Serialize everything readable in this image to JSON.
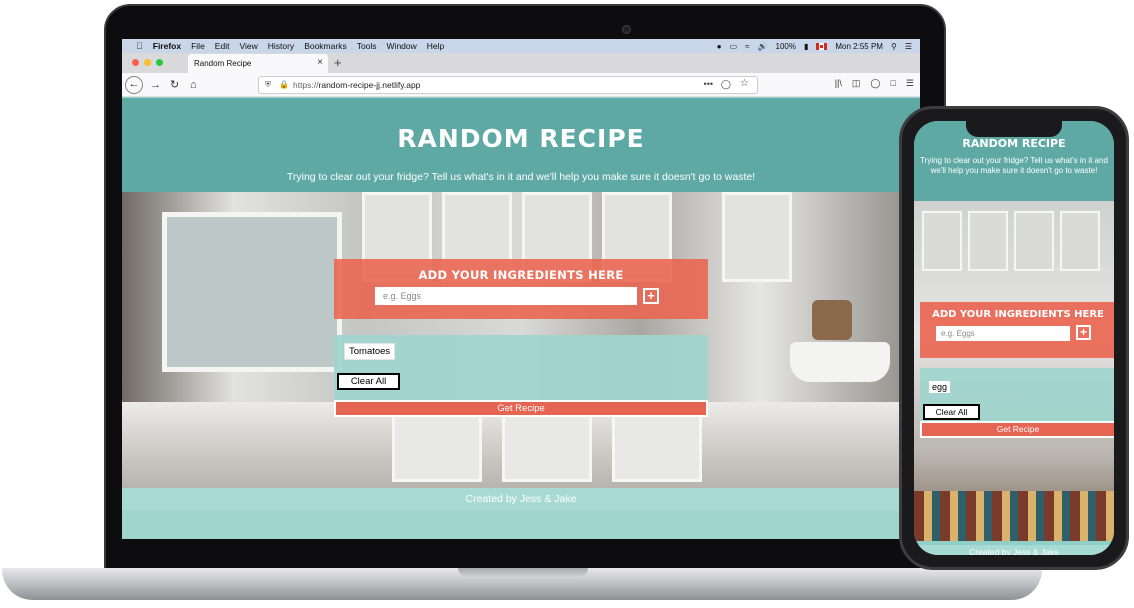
{
  "mac_menubar": {
    "app_name": "Firefox",
    "menus": [
      "File",
      "Edit",
      "View",
      "History",
      "Bookmarks",
      "Tools",
      "Window",
      "Help"
    ],
    "battery": "100%",
    "clock": "Mon 2:55 PM"
  },
  "browser": {
    "tab_title": "Random Recipe",
    "url_prefix": "https://",
    "url_domain": "random-recipe-jj.netlify.app",
    "page_actions": "•••"
  },
  "site": {
    "title": "RANDOM RECIPE",
    "tagline": "Trying to clear out your fridge? Tell us what's in it and we'll help you make sure it doesn't go to waste!",
    "ingredients_heading": "ADD YOUR INGREDIENTS HERE",
    "input_placeholder": "e.g. Eggs",
    "add_symbol": "+",
    "ingredient_chip": "Tomatoes",
    "clear_label": "Clear All",
    "get_recipe_label": "Get Recipe",
    "footer_text": "Created by Jess & Jake"
  },
  "phone": {
    "title": "RANDOM RECIPE",
    "tagline": "Trying to clear out your fridge? Tell us what's in it and we'll help you make sure it doesn't go to waste!",
    "ingredients_heading": "ADD YOUR INGREDIENTS HERE",
    "input_placeholder": "e.g. Eggs",
    "add_symbol": "+",
    "ingredient_chip": "egg",
    "clear_label": "Clear All",
    "get_recipe_label": "Get Recipe",
    "footer_text": "Created by Jess & Jake"
  },
  "colors": {
    "teal_header": "#5ea9a4",
    "mint": "#9fd5cd",
    "coral": "#e66452"
  },
  "dock_icons": [
    "finder-icon",
    "launchpad-icon",
    "safari-icon",
    "compass-icon",
    "books-icon",
    "preview-icon",
    "notes-icon",
    "calendar-icon",
    "pages-icon",
    "stickies-icon",
    "photos-icon",
    "numbers-icon",
    "keynote-icon",
    "mail-icon",
    "music-icon",
    "messages-icon",
    "firefox-icon",
    "appstore-icon",
    "chrome-icon",
    "terminal-icon",
    "word-icon",
    "zoom-icon",
    "vscode-icon",
    "slack-icon",
    "acrobat-icon",
    "trash-icon"
  ]
}
